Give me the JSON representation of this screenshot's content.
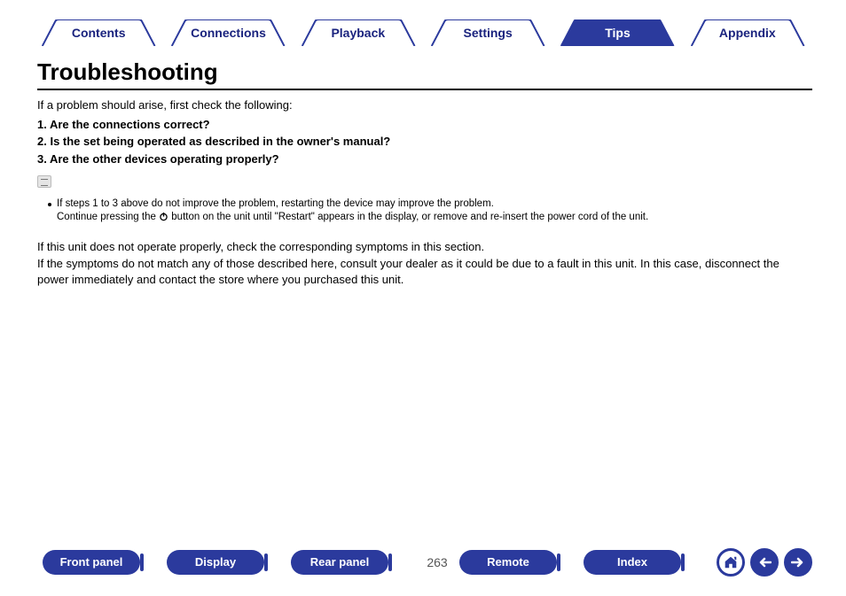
{
  "topTabs": [
    {
      "label": "Contents",
      "active": false
    },
    {
      "label": "Connections",
      "active": false
    },
    {
      "label": "Playback",
      "active": false
    },
    {
      "label": "Settings",
      "active": false
    },
    {
      "label": "Tips",
      "active": true
    },
    {
      "label": "Appendix",
      "active": false
    }
  ],
  "title": "Troubleshooting",
  "intro": "If a problem should arise, first check the following:",
  "checks": [
    "1.  Are the connections correct?",
    "2.  Is the set being operated as described in the owner's manual?",
    "3.  Are the other devices operating properly?"
  ],
  "note": {
    "line1": "If steps 1 to 3 above do not improve the problem, restarting the device may improve the problem.",
    "line2a": "Continue pressing the ",
    "line2b": " button on the unit until \"Restart\" appears in the display, or remove and re-insert the power cord of the unit."
  },
  "para1": "If this unit does not operate properly, check the corresponding symptoms in this section.",
  "para2": "If the symptoms do not match any of those described here, consult your dealer as it could be due to a fault in this unit. In this case, disconnect the power immediately and contact the store where you purchased this unit.",
  "bottom": {
    "pills": [
      "Front panel",
      "Display",
      "Rear panel",
      "Remote",
      "Index"
    ],
    "pageNumber": "263"
  },
  "colors": {
    "brand": "#2b3a9d"
  }
}
